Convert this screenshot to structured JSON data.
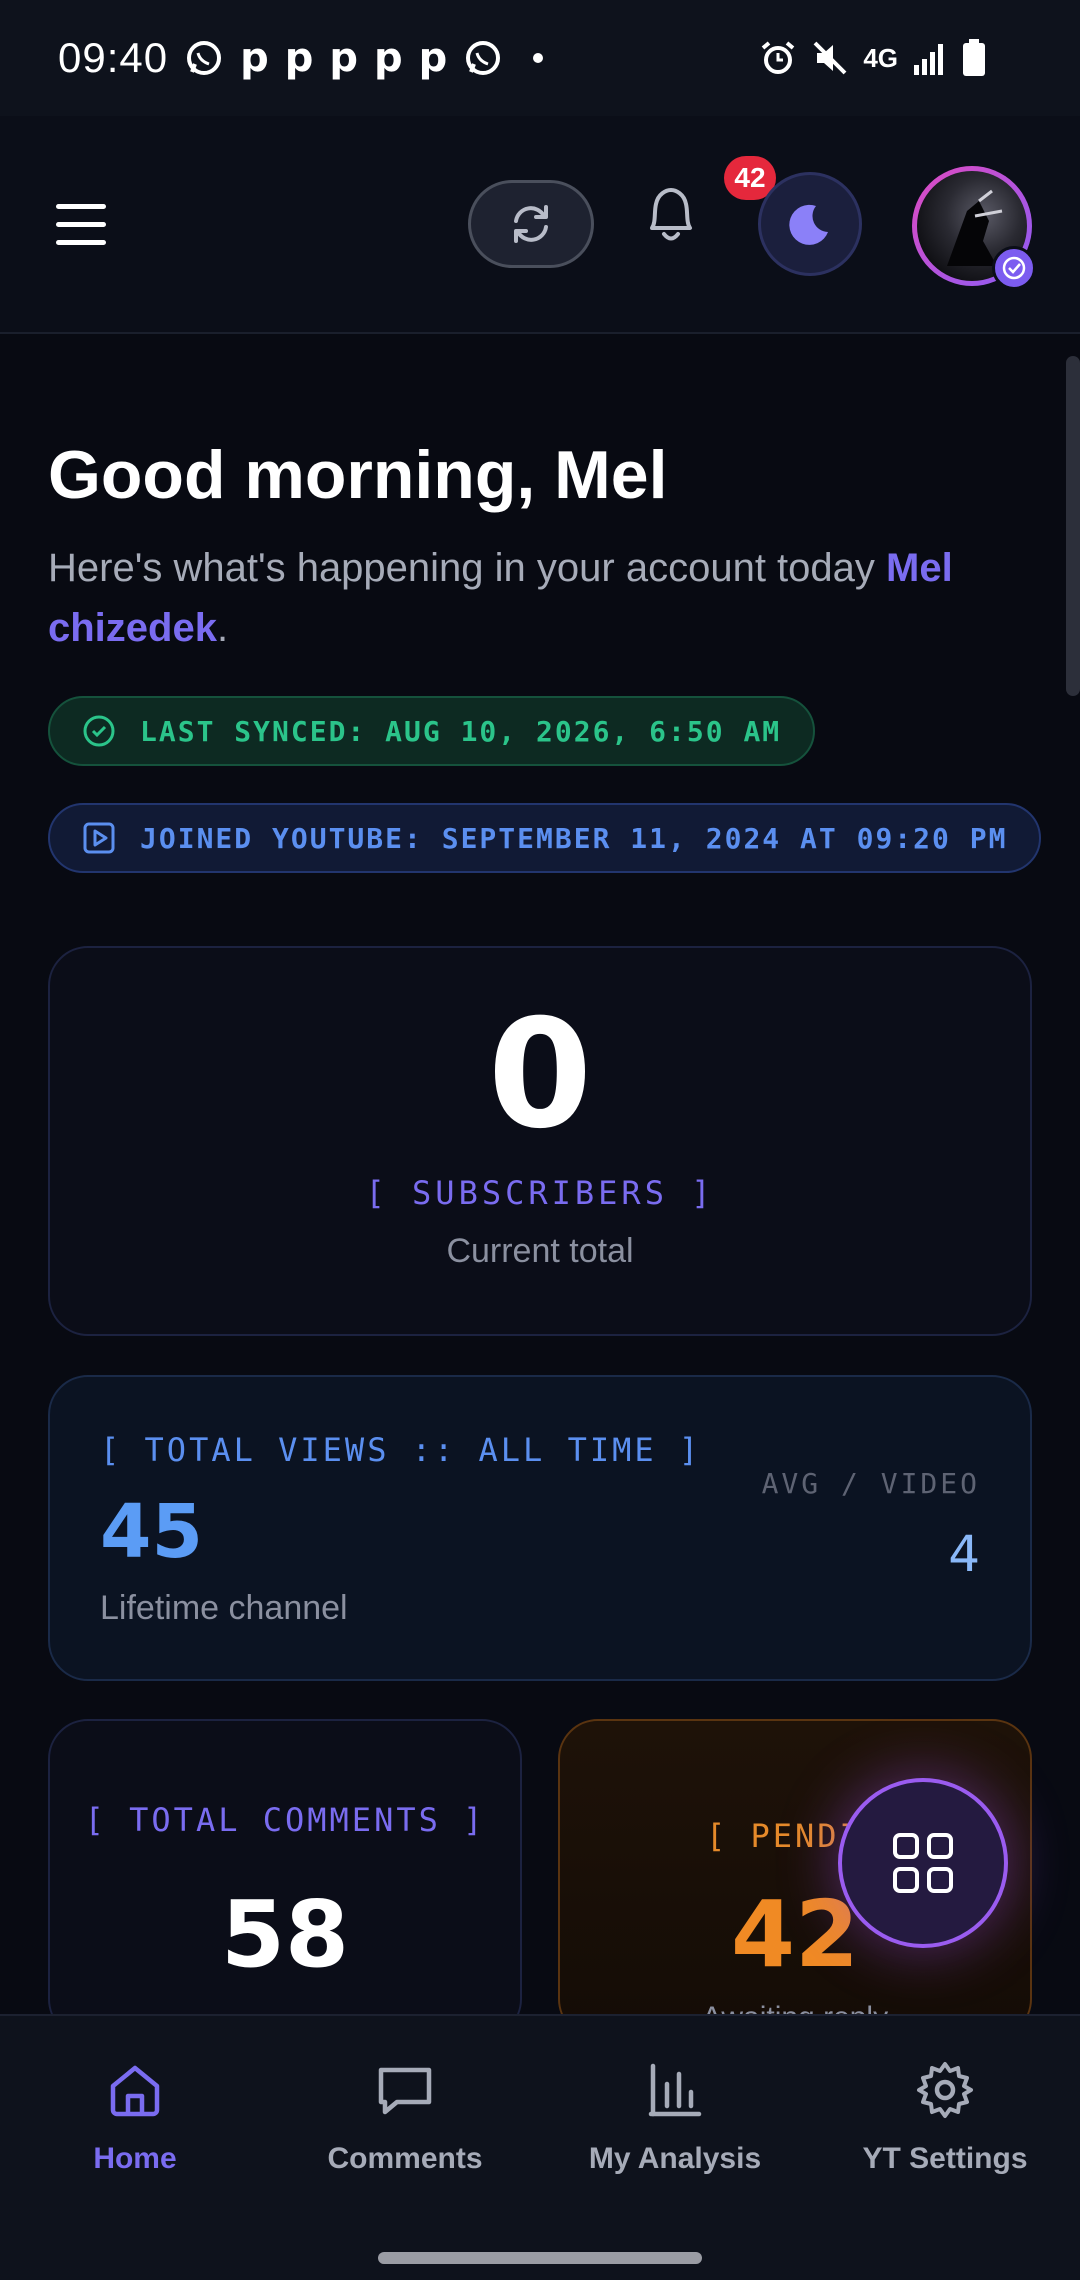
{
  "status_bar": {
    "time": "09:40",
    "notification_icons": [
      "whatsapp-icon",
      "p-icon",
      "p-icon",
      "p-icon",
      "p-icon",
      "p-icon",
      "whatsapp-icon",
      "dot"
    ],
    "network_label": "4G",
    "system_icons": [
      "alarm-icon",
      "mute-icon",
      "signal-icon",
      "battery-icon"
    ]
  },
  "header": {
    "notification_count": "42",
    "icons": [
      "menu-icon",
      "refresh-icon",
      "bell-icon",
      "moon-icon",
      "avatar",
      "verified-icon"
    ]
  },
  "greeting": {
    "title": "Good morning, Mel",
    "subtitle_prefix": "Here's what's happening in your account today ",
    "user_name": "Mel chizedek",
    "subtitle_suffix": "."
  },
  "sync_pill": {
    "label": "LAST SYNCED: AUG 10, 2026, 6:50 AM"
  },
  "joined_pill": {
    "label": "JOINED YOUTUBE: SEPTEMBER 11, 2024 AT 09:20 PM"
  },
  "subscribers_card": {
    "value": "0",
    "label": "[ SUBSCRIBERS ]",
    "caption": "Current total"
  },
  "views_card": {
    "label": "[ TOTAL VIEWS :: ALL TIME ]",
    "value": "45",
    "caption": "Lifetime channel",
    "avg_label": "AVG / VIDEO",
    "avg_value": "4"
  },
  "comments_card": {
    "label": "[ TOTAL COMMENTS ]",
    "value": "58"
  },
  "pending_card": {
    "label": "[ PENDIN",
    "value": "42",
    "caption": "Awaiting reply"
  },
  "bottom_nav": {
    "items": [
      {
        "label": "Home",
        "icon": "home-icon",
        "active": true
      },
      {
        "label": "Comments",
        "icon": "comments-icon",
        "active": false
      },
      {
        "label": "My Analysis",
        "icon": "chart-icon",
        "active": false
      },
      {
        "label": "YT Settings",
        "icon": "gear-icon",
        "active": false
      }
    ]
  },
  "colors": {
    "accent": "#7a6cf0",
    "sync_green": "#2bc48a",
    "info_blue": "#5b8ff0",
    "pending_orange": "#f08a24",
    "badge_red": "#e5283c"
  }
}
